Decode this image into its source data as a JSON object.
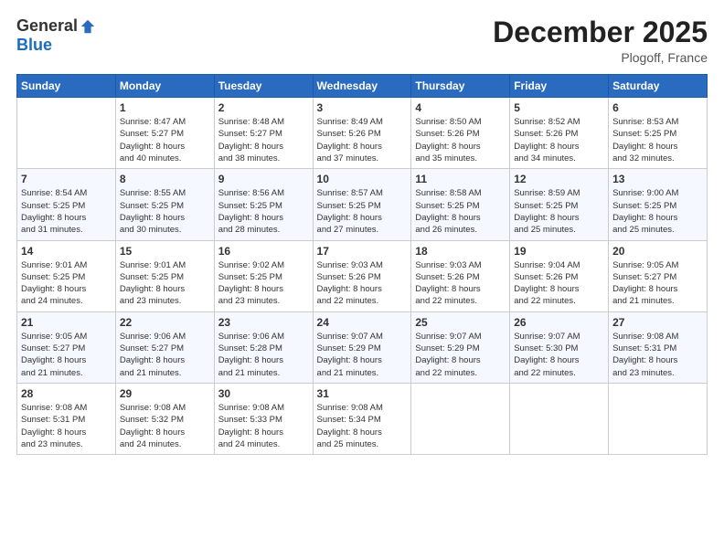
{
  "logo": {
    "general": "General",
    "blue": "Blue"
  },
  "title": "December 2025",
  "location": "Plogoff, France",
  "days_header": [
    "Sunday",
    "Monday",
    "Tuesday",
    "Wednesday",
    "Thursday",
    "Friday",
    "Saturday"
  ],
  "weeks": [
    [
      {
        "day": "",
        "info": ""
      },
      {
        "day": "1",
        "info": "Sunrise: 8:47 AM\nSunset: 5:27 PM\nDaylight: 8 hours\nand 40 minutes."
      },
      {
        "day": "2",
        "info": "Sunrise: 8:48 AM\nSunset: 5:27 PM\nDaylight: 8 hours\nand 38 minutes."
      },
      {
        "day": "3",
        "info": "Sunrise: 8:49 AM\nSunset: 5:26 PM\nDaylight: 8 hours\nand 37 minutes."
      },
      {
        "day": "4",
        "info": "Sunrise: 8:50 AM\nSunset: 5:26 PM\nDaylight: 8 hours\nand 35 minutes."
      },
      {
        "day": "5",
        "info": "Sunrise: 8:52 AM\nSunset: 5:26 PM\nDaylight: 8 hours\nand 34 minutes."
      },
      {
        "day": "6",
        "info": "Sunrise: 8:53 AM\nSunset: 5:25 PM\nDaylight: 8 hours\nand 32 minutes."
      }
    ],
    [
      {
        "day": "7",
        "info": "Sunrise: 8:54 AM\nSunset: 5:25 PM\nDaylight: 8 hours\nand 31 minutes."
      },
      {
        "day": "8",
        "info": "Sunrise: 8:55 AM\nSunset: 5:25 PM\nDaylight: 8 hours\nand 30 minutes."
      },
      {
        "day": "9",
        "info": "Sunrise: 8:56 AM\nSunset: 5:25 PM\nDaylight: 8 hours\nand 28 minutes."
      },
      {
        "day": "10",
        "info": "Sunrise: 8:57 AM\nSunset: 5:25 PM\nDaylight: 8 hours\nand 27 minutes."
      },
      {
        "day": "11",
        "info": "Sunrise: 8:58 AM\nSunset: 5:25 PM\nDaylight: 8 hours\nand 26 minutes."
      },
      {
        "day": "12",
        "info": "Sunrise: 8:59 AM\nSunset: 5:25 PM\nDaylight: 8 hours\nand 25 minutes."
      },
      {
        "day": "13",
        "info": "Sunrise: 9:00 AM\nSunset: 5:25 PM\nDaylight: 8 hours\nand 25 minutes."
      }
    ],
    [
      {
        "day": "14",
        "info": "Sunrise: 9:01 AM\nSunset: 5:25 PM\nDaylight: 8 hours\nand 24 minutes."
      },
      {
        "day": "15",
        "info": "Sunrise: 9:01 AM\nSunset: 5:25 PM\nDaylight: 8 hours\nand 23 minutes."
      },
      {
        "day": "16",
        "info": "Sunrise: 9:02 AM\nSunset: 5:25 PM\nDaylight: 8 hours\nand 23 minutes."
      },
      {
        "day": "17",
        "info": "Sunrise: 9:03 AM\nSunset: 5:26 PM\nDaylight: 8 hours\nand 22 minutes."
      },
      {
        "day": "18",
        "info": "Sunrise: 9:03 AM\nSunset: 5:26 PM\nDaylight: 8 hours\nand 22 minutes."
      },
      {
        "day": "19",
        "info": "Sunrise: 9:04 AM\nSunset: 5:26 PM\nDaylight: 8 hours\nand 22 minutes."
      },
      {
        "day": "20",
        "info": "Sunrise: 9:05 AM\nSunset: 5:27 PM\nDaylight: 8 hours\nand 21 minutes."
      }
    ],
    [
      {
        "day": "21",
        "info": "Sunrise: 9:05 AM\nSunset: 5:27 PM\nDaylight: 8 hours\nand 21 minutes."
      },
      {
        "day": "22",
        "info": "Sunrise: 9:06 AM\nSunset: 5:27 PM\nDaylight: 8 hours\nand 21 minutes."
      },
      {
        "day": "23",
        "info": "Sunrise: 9:06 AM\nSunset: 5:28 PM\nDaylight: 8 hours\nand 21 minutes."
      },
      {
        "day": "24",
        "info": "Sunrise: 9:07 AM\nSunset: 5:29 PM\nDaylight: 8 hours\nand 21 minutes."
      },
      {
        "day": "25",
        "info": "Sunrise: 9:07 AM\nSunset: 5:29 PM\nDaylight: 8 hours\nand 22 minutes."
      },
      {
        "day": "26",
        "info": "Sunrise: 9:07 AM\nSunset: 5:30 PM\nDaylight: 8 hours\nand 22 minutes."
      },
      {
        "day": "27",
        "info": "Sunrise: 9:08 AM\nSunset: 5:31 PM\nDaylight: 8 hours\nand 23 minutes."
      }
    ],
    [
      {
        "day": "28",
        "info": "Sunrise: 9:08 AM\nSunset: 5:31 PM\nDaylight: 8 hours\nand 23 minutes."
      },
      {
        "day": "29",
        "info": "Sunrise: 9:08 AM\nSunset: 5:32 PM\nDaylight: 8 hours\nand 24 minutes."
      },
      {
        "day": "30",
        "info": "Sunrise: 9:08 AM\nSunset: 5:33 PM\nDaylight: 8 hours\nand 24 minutes."
      },
      {
        "day": "31",
        "info": "Sunrise: 9:08 AM\nSunset: 5:34 PM\nDaylight: 8 hours\nand 25 minutes."
      },
      {
        "day": "",
        "info": ""
      },
      {
        "day": "",
        "info": ""
      },
      {
        "day": "",
        "info": ""
      }
    ]
  ]
}
